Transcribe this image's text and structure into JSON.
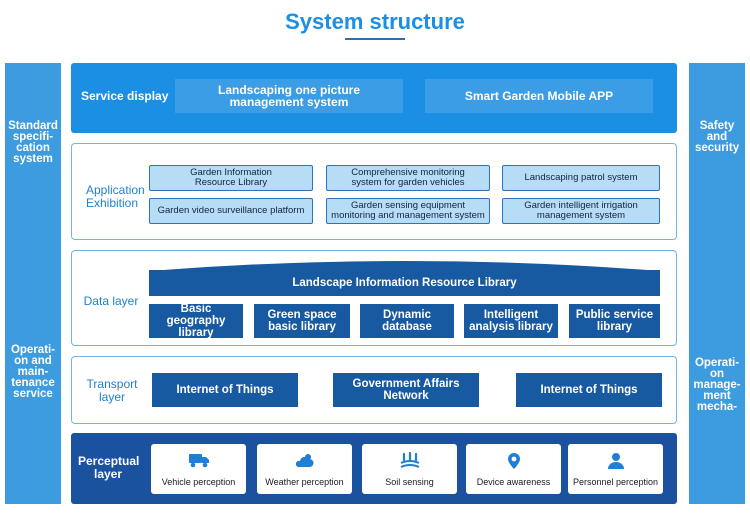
{
  "title": "System structure",
  "left_column": {
    "standard": "Standard specifi-cation system",
    "operation": "Operati-on and main-tenance service"
  },
  "right_column": {
    "safety": "Safety and security",
    "operation": "Operati-on manage-ment mecha-"
  },
  "service_layer": {
    "label": "Service display",
    "items": [
      "Landscaping one picture management system",
      "Smart Garden Mobile APP"
    ]
  },
  "application_layer": {
    "label": "Application Exhibition",
    "items": [
      "Garden Information Resource Library",
      "Comprehensive monitoring system for garden vehicles",
      "Landscaping patrol system",
      "Garden video surveillance platform",
      "Garden sensing equipment monitoring and management system",
      "Garden intelligent irrigation management system"
    ]
  },
  "data_layer": {
    "label": "Data layer",
    "banner": "Landscape Information Resource Library",
    "items": [
      "Basic geography library",
      "Green space basic library",
      "Dynamic database",
      "Intelligent analysis library",
      "Public service library"
    ]
  },
  "transport_layer": {
    "label": "Transport layer",
    "items": [
      "Internet of Things",
      "Government Affairs Network",
      "Internet of Things"
    ]
  },
  "perceptual_layer": {
    "label": "Perceptual layer",
    "items": [
      {
        "label": "Vehicle perception",
        "icon": "vehicle-icon"
      },
      {
        "label": "Weather perception",
        "icon": "weather-icon"
      },
      {
        "label": "Soil sensing",
        "icon": "soil-icon"
      },
      {
        "label": "Device awareness",
        "icon": "device-icon"
      },
      {
        "label": "Personnel perception",
        "icon": "person-icon"
      }
    ]
  },
  "colors": {
    "accent": "#1a8fe3",
    "side_column": "#3d9bdf",
    "dark_card": "#175aa2",
    "light_card": "#b7dcf6"
  }
}
